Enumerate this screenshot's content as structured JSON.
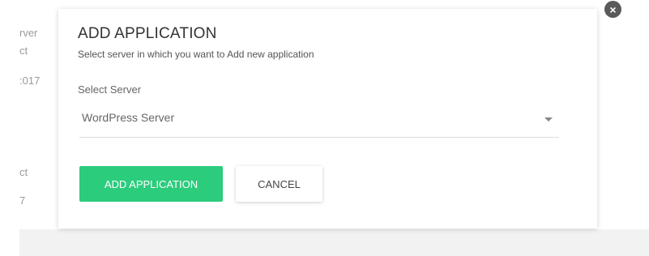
{
  "background": {
    "fragments": [
      "rver",
      "ct",
      ":017",
      "ct",
      "7"
    ]
  },
  "modal": {
    "title": "ADD APPLICATION",
    "subtitle": "Select server in which you want to Add new application",
    "select_label": "Select Server",
    "select_value": "WordPress Server",
    "primary_button": "ADD APPLICATION",
    "cancel_button": "CANCEL",
    "close_icon": "×"
  },
  "colors": {
    "primary": "#2ccc7d",
    "close": "#5a5a5a"
  }
}
